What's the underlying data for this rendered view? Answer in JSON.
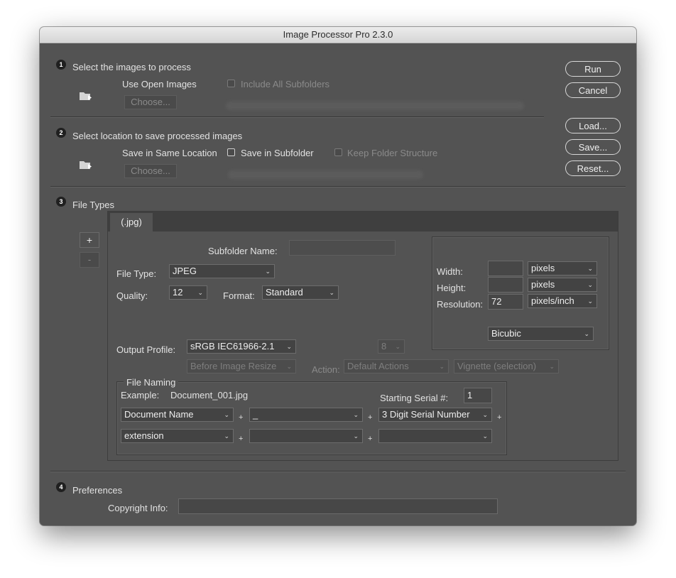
{
  "window": {
    "title": "Image Processor Pro 2.3.0"
  },
  "section1": {
    "number": "1",
    "title": "Select the images to process",
    "use_open_images": "Use Open Images",
    "include_subfolders": "Include All Subfolders",
    "choose": "Choose..."
  },
  "section2": {
    "number": "2",
    "title": "Select location to save processed images",
    "save_same_location": "Save in Same Location",
    "save_in_subfolder": "Save in Subfolder",
    "keep_folder_structure": "Keep Folder Structure",
    "choose": "Choose..."
  },
  "section3": {
    "number": "3",
    "title": "File Types",
    "add": "+",
    "remove": "-",
    "tab": "(.jpg)",
    "subfolder_name_label": "Subfolder Name:",
    "subfolder_name_value": "",
    "file_type_label": "File Type:",
    "file_type_value": "JPEG",
    "quality_label": "Quality:",
    "quality_value": "12",
    "format_label": "Format:",
    "format_value": "Standard",
    "width_label": "Width:",
    "width_value": "",
    "width_unit": "pixels",
    "height_label": "Height:",
    "height_value": "",
    "height_unit": "pixels",
    "resolution_label": "Resolution:",
    "resolution_value": "72",
    "resolution_unit": "pixels/inch",
    "resample": "Bicubic",
    "output_profile_label": "Output Profile:",
    "output_profile_value": "sRGB IEC61966-2.1",
    "bit_depth": "8",
    "profile_timing": "Before Image Resize",
    "action_label": "Action:",
    "action_set": "Default Actions",
    "action": "Vignette (selection)",
    "file_naming": {
      "title": "File Naming",
      "example_label": "Example:",
      "example_value": "Document_001.jpg",
      "starting_serial_label": "Starting Serial #:",
      "starting_serial_value": "1",
      "field1": "Document Name",
      "field2": "_",
      "field3": "3 Digit Serial Number",
      "field4": "extension",
      "field5": "",
      "field6": "",
      "plus": "+"
    }
  },
  "section4": {
    "number": "4",
    "title": "Preferences",
    "copyright_label": "Copyright Info:",
    "copyright_value": ""
  },
  "buttons": {
    "run": "Run",
    "cancel": "Cancel",
    "load": "Load...",
    "save": "Save...",
    "reset": "Reset..."
  },
  "icons": {
    "folder_arrow": "folder-arrow-icon",
    "chevron": "chevron-down-icon"
  }
}
